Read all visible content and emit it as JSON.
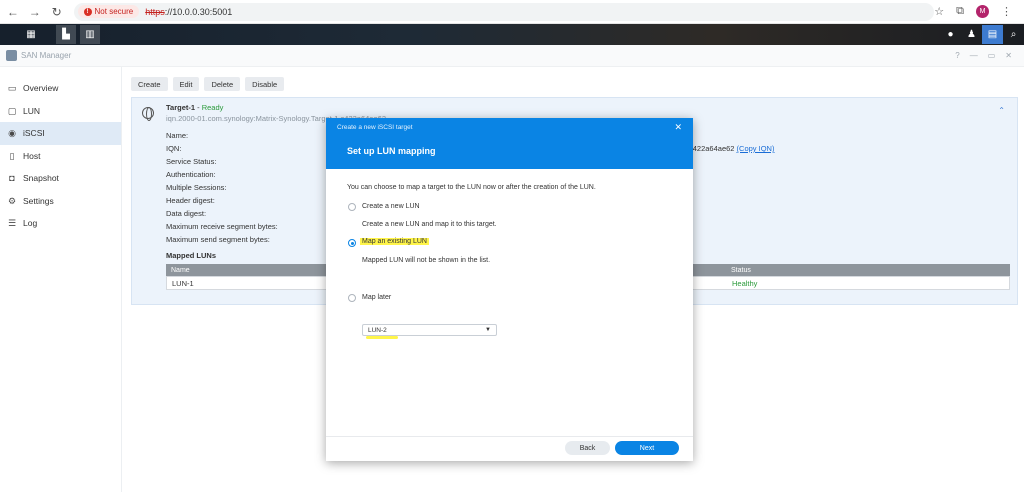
{
  "browser": {
    "not_secure": "Not secure",
    "url_scheme": "https",
    "url_rest": "://10.0.0.30:5001",
    "profile_initial": "M"
  },
  "app": {
    "title": "SAN Manager",
    "window_controls": [
      "?",
      "—",
      "▭",
      "✕"
    ]
  },
  "sidebar": {
    "items": [
      {
        "label": "Overview",
        "icon": "overview-icon"
      },
      {
        "label": "LUN",
        "icon": "lun-icon"
      },
      {
        "label": "iSCSI",
        "icon": "iscsi-icon",
        "active": true
      },
      {
        "label": "Host",
        "icon": "host-icon"
      },
      {
        "label": "Snapshot",
        "icon": "camera-icon"
      },
      {
        "label": "Settings",
        "icon": "gear-icon"
      },
      {
        "label": "Log",
        "icon": "list-icon"
      }
    ]
  },
  "toolbar": {
    "create": "Create",
    "edit": "Edit",
    "delete": "Delete",
    "disable": "Disable"
  },
  "target": {
    "name": "Target-1",
    "dash": " - ",
    "status": "Ready",
    "iqn": "iqn.2000-01.com.synology:Matrix-Synology.Target-1.c422a64ae62",
    "props": [
      "Name:",
      "IQN:",
      "Service Status:",
      "Authentication:",
      "Multiple Sessions:",
      "Header digest:",
      "Data digest:",
      "Maximum receive segment bytes:",
      "Maximum send segment bytes:"
    ],
    "iqn_tail": "c422a64ae62 ",
    "copy_iqn": "(Copy IQN)",
    "mapped_title": "Mapped LUNs",
    "table": {
      "headers": {
        "name": "Name",
        "status": "Status"
      },
      "rows": [
        {
          "name": "LUN-1",
          "status": "Healthy"
        }
      ]
    }
  },
  "dialog": {
    "window_title": "Create a new iSCSI target",
    "title": "Set up LUN mapping",
    "intro": "You can choose to map a target to the LUN now or after the creation of the LUN.",
    "options": [
      {
        "label": "Create a new LUN",
        "desc": "Create a new LUN and map it to this target.",
        "selected": false
      },
      {
        "label": "Map an existing LUN",
        "desc": "Mapped LUN will not be shown in the list.",
        "selected": true
      },
      {
        "label": "Map later",
        "selected": false
      }
    ],
    "select_value": "LUN-2",
    "back": "Back",
    "next": "Next"
  },
  "colors": {
    "accent": "#0a84e4",
    "healthy": "#2a9a3a",
    "highlight": "#fff54a"
  }
}
